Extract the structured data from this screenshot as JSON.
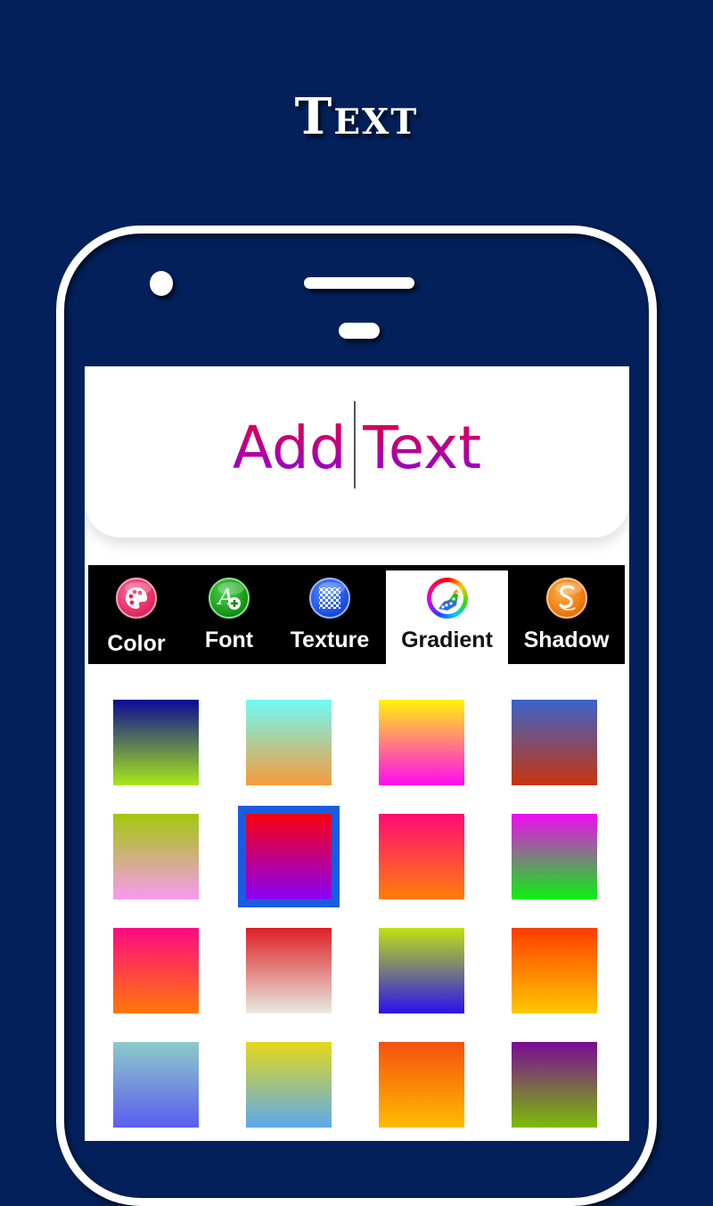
{
  "headline": "Text",
  "preview": {
    "text_before_cursor": "Add",
    "text_after_cursor": "Text",
    "text_gradient": [
      "#e8003a",
      "#8a00e6"
    ]
  },
  "tabs": [
    {
      "id": "color",
      "label": "Color",
      "icon": "palette-icon",
      "icon_color": "#ec3c78",
      "active": false
    },
    {
      "id": "font",
      "label": "Font",
      "icon": "font-add-icon",
      "icon_color": "#1ea41e",
      "active": false
    },
    {
      "id": "texture",
      "label": "Texture",
      "icon": "checker-texture-icon",
      "icon_color": "#1f5fe8",
      "active": false
    },
    {
      "id": "gradient",
      "label": "Gradient",
      "icon": "rainbow-gradient-icon",
      "icon_color": "#ffffff",
      "active": true
    },
    {
      "id": "shadow",
      "label": "Shadow",
      "icon": "shadow-s-icon",
      "icon_color": "#f5820f",
      "active": false
    }
  ],
  "gradients": [
    {
      "top": "#0a0a96",
      "bottom": "#a6e81a",
      "selected": false
    },
    {
      "top": "#6ffcf6",
      "bottom": "#f79a3a",
      "selected": false
    },
    {
      "top": "#fff40a",
      "bottom": "#ff0af2",
      "selected": false
    },
    {
      "top": "#3a64cc",
      "bottom": "#c8340a",
      "selected": false
    },
    {
      "top": "#a2c80c",
      "bottom": "#f99af0",
      "selected": false
    },
    {
      "top": "#f8000e",
      "bottom": "#8800f8",
      "selected": true
    },
    {
      "top": "#ff0a74",
      "bottom": "#ff7e0a",
      "selected": false
    },
    {
      "top": "#f00af2",
      "bottom": "#0af20e",
      "selected": false
    },
    {
      "top": "#ff0a82",
      "bottom": "#ff780a",
      "selected": false
    },
    {
      "top": "#dd1f24",
      "bottom": "#e8ebe2",
      "selected": false
    },
    {
      "top": "#c2e20f",
      "bottom": "#2a0ff0",
      "selected": false
    },
    {
      "top": "#ff3c00",
      "bottom": "#ffc800",
      "selected": false
    },
    {
      "top": "#8ccbc8",
      "bottom": "#5c5ef0",
      "selected": false
    },
    {
      "top": "#e6d81a",
      "bottom": "#5aaaf0",
      "selected": false
    },
    {
      "top": "#f5500f",
      "bottom": "#ffbc00",
      "selected": false
    },
    {
      "top": "#7a0a96",
      "bottom": "#7cbc06",
      "selected": false
    }
  ]
}
